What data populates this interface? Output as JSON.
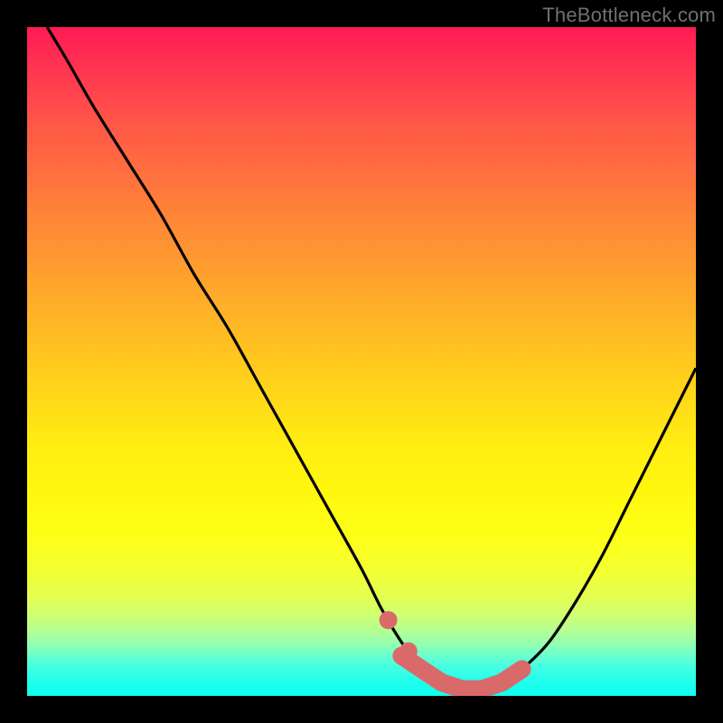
{
  "watermark": "TheBottleneck.com",
  "chart_data": {
    "type": "line",
    "title": "",
    "xlabel": "",
    "ylabel": "",
    "xlim": [
      0,
      100
    ],
    "ylim": [
      0,
      100
    ],
    "series": [
      {
        "name": "bottleneck-curve",
        "x": [
          3,
          6,
          10,
          15,
          20,
          25,
          30,
          35,
          40,
          45,
          50,
          53,
          56,
          59,
          62,
          65,
          68,
          71,
          74,
          78,
          82,
          86,
          90,
          94,
          98,
          100
        ],
        "values": [
          100,
          95,
          88,
          80,
          72,
          63,
          55,
          46,
          37,
          28,
          19,
          13,
          8,
          4,
          2,
          1,
          1,
          2,
          4,
          8,
          14,
          21,
          29,
          37,
          45,
          49
        ]
      }
    ],
    "highlight_region": {
      "name": "optimal-zone",
      "x_start": 56,
      "x_end": 77,
      "value_max": 6
    },
    "colors": {
      "curve": "#000000",
      "highlight": "#da6a6a",
      "background_top": "#ff1a55",
      "background_bottom": "#0efff0"
    }
  }
}
